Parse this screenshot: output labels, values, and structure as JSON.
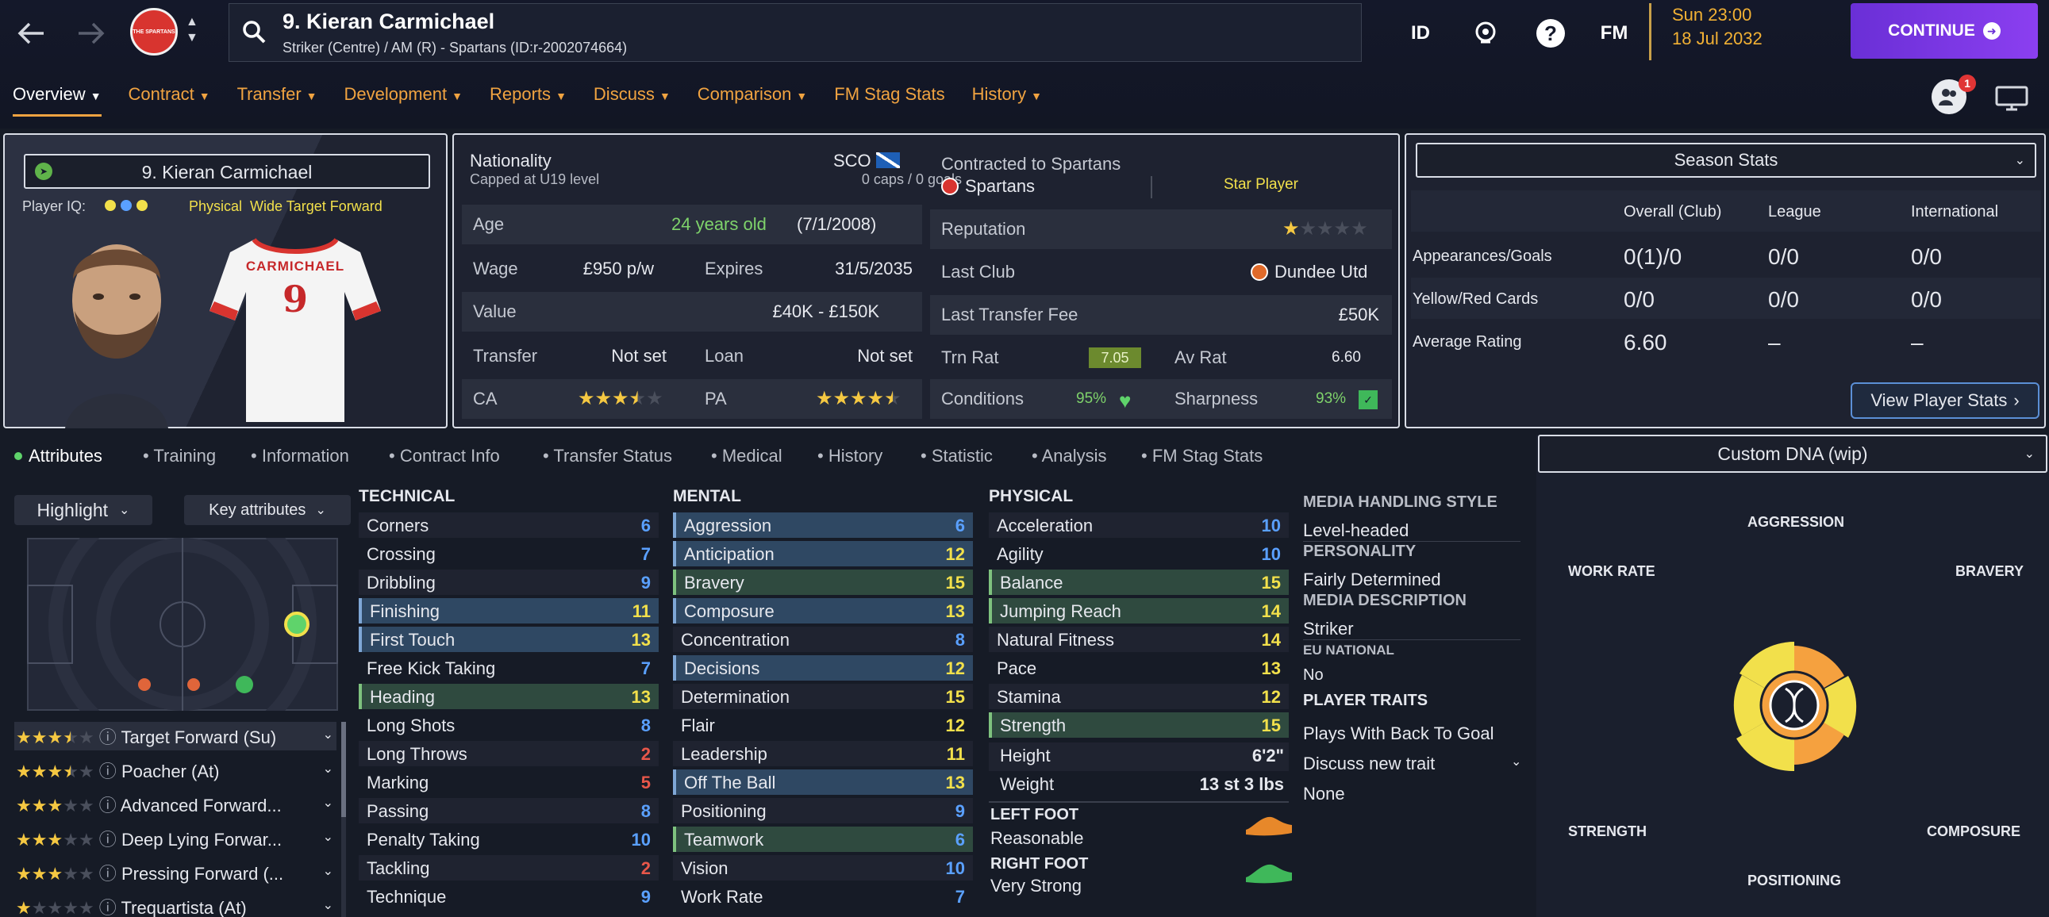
{
  "header": {
    "player_name": "9. Kieran Carmichael",
    "player_sub": "Striker (Centre) / AM (R) - Spartans (ID:r-2002074664)",
    "club_badge_text": "THE SPARTANS",
    "icon_id": "ID",
    "icon_fm": "FM",
    "date_time": "Sun 23:00",
    "date": "18 Jul 2032",
    "continue": "CONTINUE",
    "notif_count": "1"
  },
  "tabs": [
    {
      "label": "Overview"
    },
    {
      "label": "Contract"
    },
    {
      "label": "Transfer"
    },
    {
      "label": "Development"
    },
    {
      "label": "Reports"
    },
    {
      "label": "Discuss"
    },
    {
      "label": "Comparison"
    },
    {
      "label": "FM Stag Stats"
    },
    {
      "label": "History"
    }
  ],
  "profile": {
    "name": "9. Kieran Carmichael",
    "player_iq_label": "Player IQ:",
    "role_text": "Physical  Wide Target Forward",
    "shirt_name": "CARMICHAEL",
    "shirt_number": "9"
  },
  "info": {
    "nationality_label": "Nationality",
    "nationality": "SCO",
    "capped": "Capped at U19 level",
    "caps": "0 caps / 0 goals",
    "contracted_label": "Contracted to Spartans",
    "club": "Spartans",
    "status": "Star Player",
    "age_label": "Age",
    "age": "24 years old",
    "dob": "(7/1/2008)",
    "reputation_label": "Reputation",
    "wage_label": "Wage",
    "wage": "£950 p/w",
    "expires_label": "Expires",
    "expires": "31/5/2035",
    "last_club_label": "Last Club",
    "last_club": "Dundee Utd",
    "value_label": "Value",
    "value": "£40K - £150K",
    "last_fee_label": "Last Transfer Fee",
    "last_fee": "£50K",
    "transfer_label": "Transfer",
    "transfer": "Not set",
    "loan_label": "Loan",
    "loan": "Not set",
    "trn_rat_label": "Trn Rat",
    "trn_rat": "7.05",
    "av_rat_label": "Av Rat",
    "av_rat": "6.60",
    "ca_label": "CA",
    "pa_label": "PA",
    "ca_stars": 3.5,
    "pa_stars": 4.5,
    "reputation_stars": 1,
    "conditions_label": "Conditions",
    "conditions": "95%",
    "sharpness_label": "Sharpness",
    "sharpness": "93%"
  },
  "season": {
    "title": "Season Stats",
    "cols": [
      "Overall (Club)",
      "League",
      "International"
    ],
    "rows": [
      {
        "label": "Appearances/Goals",
        "vals": [
          "0(1)/0",
          "0/0",
          "0/0"
        ]
      },
      {
        "label": "Yellow/Red Cards",
        "vals": [
          "0/0",
          "0/0",
          "0/0"
        ]
      },
      {
        "label": "Average Rating",
        "vals": [
          "6.60",
          "–",
          "–"
        ]
      }
    ],
    "view_btn": "View Player Stats"
  },
  "subtabs": [
    "Attributes",
    "Training",
    "Information",
    "Contract Info",
    "Transfer Status",
    "Medical",
    "History",
    "Statistic",
    "Analysis",
    "FM Stag Stats"
  ],
  "controls": {
    "highlight": "Highlight",
    "key_attrs": "Key attributes"
  },
  "roles": [
    {
      "name": "Target Forward (Su)",
      "stars": 3.5
    },
    {
      "name": "Poacher (At)",
      "stars": 3.5
    },
    {
      "name": "Advanced Forward...",
      "stars": 3
    },
    {
      "name": "Deep Lying Forwar...",
      "stars": 3
    },
    {
      "name": "Pressing Forward (...",
      "stars": 3
    },
    {
      "name": "Trequartista (At)",
      "stars": 1
    }
  ],
  "technical": {
    "title": "TECHNICAL",
    "items": [
      [
        "Corners",
        "6"
      ],
      [
        "Crossing",
        "7"
      ],
      [
        "Dribbling",
        "9"
      ],
      [
        "Finishing",
        "11"
      ],
      [
        "First Touch",
        "13"
      ],
      [
        "Free Kick Taking",
        "7"
      ],
      [
        "Heading",
        "13"
      ],
      [
        "Long Shots",
        "8"
      ],
      [
        "Long Throws",
        "2"
      ],
      [
        "Marking",
        "5"
      ],
      [
        "Passing",
        "8"
      ],
      [
        "Penalty Taking",
        "10"
      ],
      [
        "Tackling",
        "2"
      ],
      [
        "Technique",
        "9"
      ]
    ]
  },
  "mental": {
    "title": "MENTAL",
    "items": [
      [
        "Aggression",
        "6"
      ],
      [
        "Anticipation",
        "12"
      ],
      [
        "Bravery",
        "15"
      ],
      [
        "Composure",
        "13"
      ],
      [
        "Concentration",
        "8"
      ],
      [
        "Decisions",
        "12"
      ],
      [
        "Determination",
        "15"
      ],
      [
        "Flair",
        "12"
      ],
      [
        "Leadership",
        "11"
      ],
      [
        "Off The Ball",
        "13"
      ],
      [
        "Positioning",
        "9"
      ],
      [
        "Teamwork",
        "6"
      ],
      [
        "Vision",
        "10"
      ],
      [
        "Work Rate",
        "7"
      ]
    ]
  },
  "physical": {
    "title": "PHYSICAL",
    "items": [
      [
        "Acceleration",
        "10"
      ],
      [
        "Agility",
        "10"
      ],
      [
        "Balance",
        "15"
      ],
      [
        "Jumping Reach",
        "14"
      ],
      [
        "Natural Fitness",
        "14"
      ],
      [
        "Pace",
        "13"
      ],
      [
        "Stamina",
        "12"
      ],
      [
        "Strength",
        "15"
      ]
    ],
    "height_label": "Height",
    "height": "6'2\"",
    "weight_label": "Weight",
    "weight": "13 st 3 lbs",
    "left_foot_label": "LEFT FOOT",
    "left_foot": "Reasonable",
    "right_foot_label": "RIGHT FOOT",
    "right_foot": "Very Strong"
  },
  "media": {
    "style_label": "MEDIA HANDLING STYLE",
    "style": "Level-headed",
    "personality_label": "PERSONALITY",
    "personality": "Fairly Determined",
    "desc_label": "MEDIA DESCRIPTION",
    "desc": "Striker",
    "eu_label": "EU NATIONAL",
    "eu": "No",
    "traits_label": "PLAYER TRAITS",
    "trait1": "Plays With Back To Goal",
    "discuss": "Discuss new trait",
    "trait2": "None"
  },
  "dna": {
    "title": "Custom DNA (wip)",
    "labels": [
      "AGGRESSION",
      "WORK RATE",
      "BRAVERY",
      "STRENGTH",
      "COMPOSURE",
      "POSITIONING"
    ]
  },
  "colors": {
    "accent": "#f0a341",
    "blue_val": "#5aa0ff",
    "yellow_val": "#f2e04b",
    "red_val": "#e8574a",
    "green": "#5fd36b"
  }
}
